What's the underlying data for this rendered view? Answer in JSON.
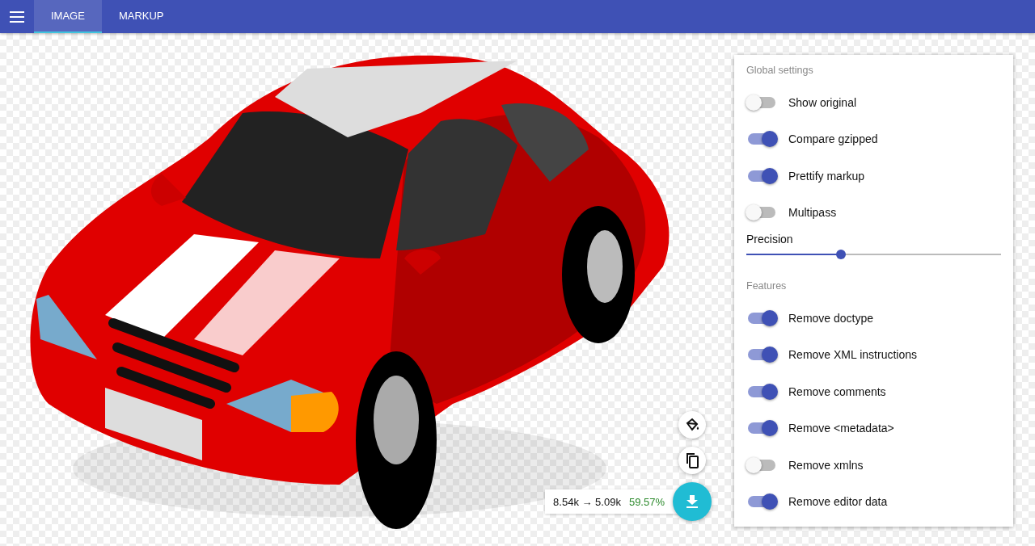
{
  "tabs": [
    {
      "label": "IMAGE",
      "selected": true
    },
    {
      "label": "MARKUP",
      "selected": false
    }
  ],
  "settings": {
    "global_title": "Global settings",
    "global": [
      {
        "label": "Show original",
        "on": false
      },
      {
        "label": "Compare gzipped",
        "on": true
      },
      {
        "label": "Prettify markup",
        "on": true
      },
      {
        "label": "Multipass",
        "on": false
      }
    ],
    "precision": {
      "label": "Precision",
      "level": 0.373
    },
    "features_title": "Features",
    "features": [
      {
        "label": "Remove doctype",
        "on": true
      },
      {
        "label": "Remove XML instructions",
        "on": true
      },
      {
        "label": "Remove comments",
        "on": true
      },
      {
        "label": "Remove <metadata>",
        "on": true
      },
      {
        "label": "Remove xmlns",
        "on": false
      },
      {
        "label": "Remove editor data",
        "on": true
      }
    ]
  },
  "result": {
    "sizes": "8.54k → 5.09k",
    "saving": "59.57%"
  }
}
